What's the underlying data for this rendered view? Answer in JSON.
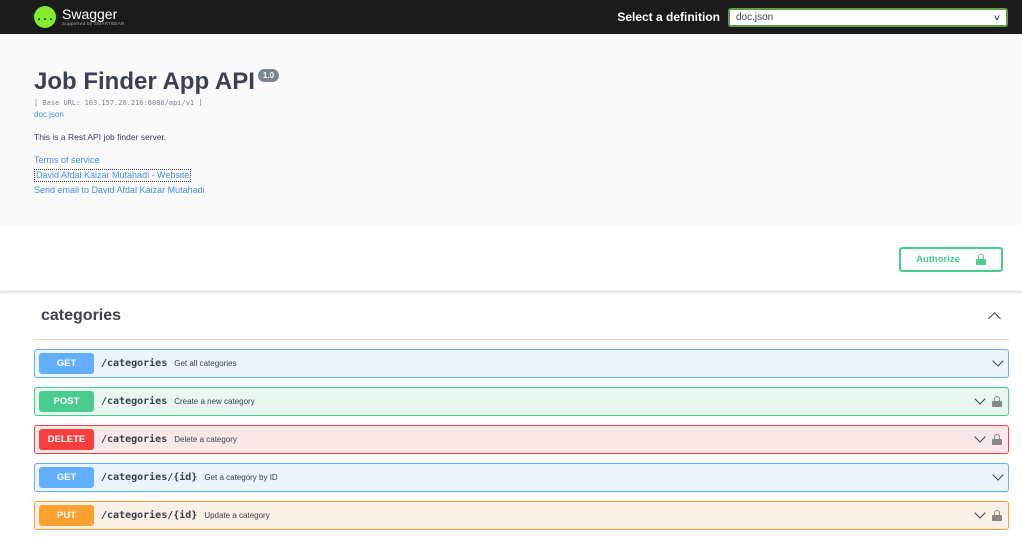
{
  "topbar": {
    "logo_icon": "{...}",
    "logo_title": "Swagger",
    "logo_sub": "Supported by SMARTBEAR",
    "select_label": "Select a definition",
    "selected_definition": "doc.json"
  },
  "info": {
    "title": "Job Finder App API",
    "version": "1.0",
    "base_url": "[ Base URL: 103.157.26.216:8080/api/v1 ]",
    "doc_link": "doc.json",
    "description": "This is a Rest API job finder server.",
    "terms": "Terms of service",
    "website": "David Afdal Kaizar Mutahadi - Website",
    "email": "Send email to David Afdal Kaizar Mutahadi"
  },
  "auth": {
    "label": "Authorize",
    "icon": "lock-icon"
  },
  "tag": {
    "name": "categories"
  },
  "operations": [
    {
      "method": "GET",
      "path": "/categories",
      "summary": "Get all categories",
      "locked": false
    },
    {
      "method": "POST",
      "path": "/categories",
      "summary": "Create a new category",
      "locked": true
    },
    {
      "method": "DELETE",
      "path": "/categories",
      "summary": "Delete a category",
      "locked": true
    },
    {
      "method": "GET",
      "path": "/categories/{id}",
      "summary": "Get a category by ID",
      "locked": false
    },
    {
      "method": "PUT",
      "path": "/categories/{id}",
      "summary": "Update a category",
      "locked": true
    }
  ],
  "colors": {
    "get": "#61affe",
    "post": "#49cc90",
    "delete": "#f93e3e",
    "put": "#fca130",
    "topbar": "#1b1b1b",
    "logo": "#85ea2d"
  }
}
